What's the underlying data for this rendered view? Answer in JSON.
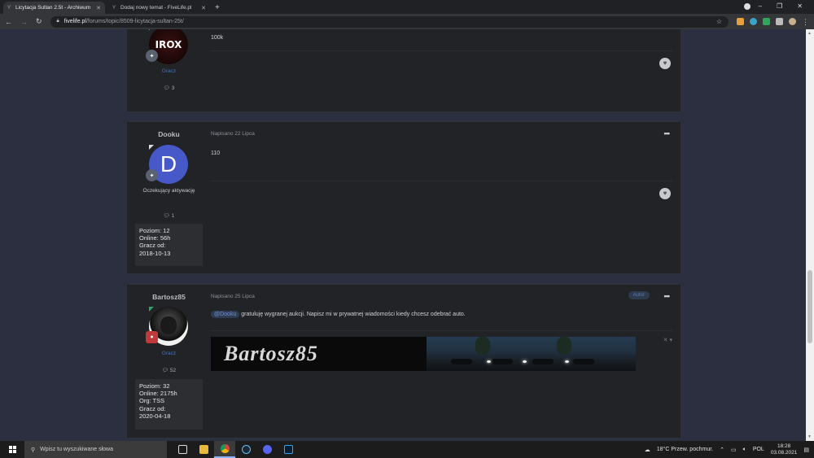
{
  "browser": {
    "tabs": [
      {
        "title": "Licytacja Sultan 2.5t - Archiwum",
        "active": true
      },
      {
        "title": "Dodaj nowy temat - FiveLife.pl",
        "active": false
      }
    ],
    "new_tab": "+",
    "url_host": "fivelife.pl",
    "url_path": "/forums/topic/8509-licytacja-sultan-25t/",
    "window_controls": {
      "minimize": "–",
      "maximize": "❐",
      "close": "✕"
    }
  },
  "posts": [
    {
      "author": "",
      "avatar_text": "IROX",
      "group": "Gracz",
      "post_count": "3",
      "body_text": "100k"
    },
    {
      "author": "Dooku",
      "avatar_letter": "D",
      "group": "Oczekujący aktywację",
      "post_count": "1",
      "stats": [
        "Poziom: 12",
        "Online: 56h",
        "Gracz od:",
        "2018-10-13"
      ],
      "meta": "Napisano 22 Lipca",
      "more": "•••",
      "body_text": "110"
    },
    {
      "author": "Bartosz85",
      "group": "Gracz",
      "post_count": "52",
      "stats": [
        "Poziom: 32",
        "Online: 2175h",
        "Org: TSS",
        "Gracz od:",
        "2020-04-18"
      ],
      "meta": "Napisano 25 Lipca",
      "author_badge": "Autor",
      "more": "•••",
      "mention": "@Dooku",
      "body_text": " gratuluję  wygranej aukcji. Napisz mi w prywatnej wiadomości kiedy chcesz odebrać auto.",
      "signature_text": "Bartosz85"
    }
  ],
  "taskbar": {
    "search_placeholder": "Wpisz tu wyszukiwane słowa",
    "weather": "18°C  Przew. pochmur.",
    "language": "POL",
    "time": "18:28",
    "date": "03.08.2021"
  },
  "colors": {
    "page_bg": "#2b2f3f",
    "post_bg": "#222326",
    "group_gracz": "#4a74b8",
    "avatar_d": "#4758c8"
  }
}
